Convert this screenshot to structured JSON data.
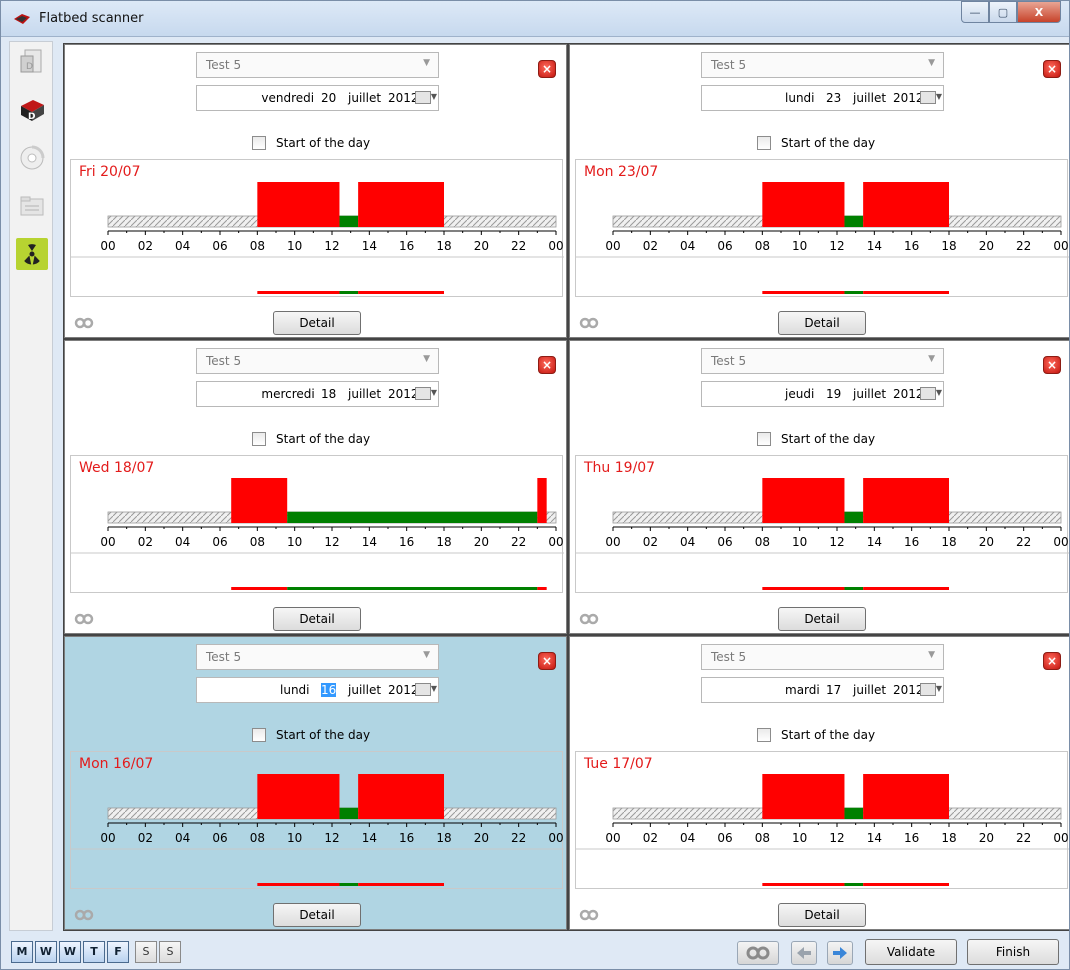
{
  "window": {
    "title": "Flatbed scanner",
    "minimize": "—",
    "maximize": "▢",
    "close": "X"
  },
  "sidebar": {
    "items": [
      {
        "icon": "document-scan-icon"
      },
      {
        "icon": "flatbed-scanner-icon"
      },
      {
        "icon": "disc-icon"
      },
      {
        "icon": "folder-icon"
      },
      {
        "icon": "hazard-icon"
      }
    ]
  },
  "colors": {
    "work": "#ff0000",
    "break": "#008000",
    "day_label": "#e31b1b",
    "selected_panel": "#b0d5e3"
  },
  "hour_ticks": [
    "00",
    "02",
    "04",
    "06",
    "08",
    "10",
    "12",
    "14",
    "16",
    "18",
    "20",
    "22",
    "00"
  ],
  "panels": [
    {
      "combo": "Test 5",
      "weekday": "vendredi",
      "day": "20",
      "month": "juillet",
      "year": "2012",
      "start_of_day_label": "Start of the day",
      "day_label": "Fri 20/07",
      "detail_label": "Detail",
      "segments": [
        {
          "type": "work",
          "from": 8,
          "to": 12.4,
          "h": 1
        },
        {
          "type": "break",
          "from": 12.4,
          "to": 13.4,
          "h": 0.25
        },
        {
          "type": "work",
          "from": 13.4,
          "to": 18,
          "h": 1
        }
      ]
    },
    {
      "combo": "Test 5",
      "weekday": "lundi",
      "day": "23",
      "month": "juillet",
      "year": "2012",
      "start_of_day_label": "Start of the day",
      "day_label": "Mon 23/07",
      "detail_label": "Detail",
      "segments": [
        {
          "type": "work",
          "from": 8,
          "to": 12.4,
          "h": 1
        },
        {
          "type": "break",
          "from": 12.4,
          "to": 13.4,
          "h": 0.25
        },
        {
          "type": "work",
          "from": 13.4,
          "to": 18,
          "h": 1
        }
      ]
    },
    {
      "combo": "Test 5",
      "weekday": "mercredi",
      "day": "18",
      "month": "juillet",
      "year": "2012",
      "start_of_day_label": "Start of the day",
      "day_label": "Wed 18/07",
      "detail_label": "Detail",
      "segments": [
        {
          "type": "work",
          "from": 6.6,
          "to": 9.6,
          "h": 1
        },
        {
          "type": "break",
          "from": 9.6,
          "to": 23,
          "h": 0.25
        },
        {
          "type": "work",
          "from": 23,
          "to": 23.5,
          "h": 1
        }
      ]
    },
    {
      "combo": "Test 5",
      "weekday": "jeudi",
      "day": "19",
      "month": "juillet",
      "year": "2012",
      "start_of_day_label": "Start of the day",
      "day_label": "Thu 19/07",
      "detail_label": "Detail",
      "segments": [
        {
          "type": "work",
          "from": 8,
          "to": 12.4,
          "h": 1
        },
        {
          "type": "break",
          "from": 12.4,
          "to": 13.4,
          "h": 0.25
        },
        {
          "type": "work",
          "from": 13.4,
          "to": 18,
          "h": 1
        }
      ]
    },
    {
      "combo": "Test 5",
      "weekday": "lundi",
      "day": "16",
      "month": "juillet",
      "year": "2012",
      "start_of_day_label": "Start of the day",
      "day_label": "Mon 16/07",
      "detail_label": "Detail",
      "selected": true,
      "day_highlighted": true,
      "segments": [
        {
          "type": "work",
          "from": 8,
          "to": 12.4,
          "h": 1
        },
        {
          "type": "break",
          "from": 12.4,
          "to": 13.4,
          "h": 0.25
        },
        {
          "type": "work",
          "from": 13.4,
          "to": 18,
          "h": 1
        }
      ]
    },
    {
      "combo": "Test 5",
      "weekday": "mardi",
      "day": "17",
      "month": "juillet",
      "year": "2012",
      "start_of_day_label": "Start of the day",
      "day_label": "Tue 17/07",
      "detail_label": "Detail",
      "segments": [
        {
          "type": "work",
          "from": 8,
          "to": 12.4,
          "h": 1
        },
        {
          "type": "break",
          "from": 12.4,
          "to": 13.4,
          "h": 0.25
        },
        {
          "type": "work",
          "from": 13.4,
          "to": 18,
          "h": 1
        }
      ]
    }
  ],
  "bottom": {
    "day_buttons": [
      {
        "label": "M",
        "active": true
      },
      {
        "label": "W",
        "active": true
      },
      {
        "label": "W",
        "active": true
      },
      {
        "label": "T",
        "active": true
      },
      {
        "label": "F",
        "active": true
      },
      {
        "label": "S",
        "active": false
      },
      {
        "label": "S",
        "active": false
      }
    ],
    "validate": "Validate",
    "finish": "Finish"
  }
}
